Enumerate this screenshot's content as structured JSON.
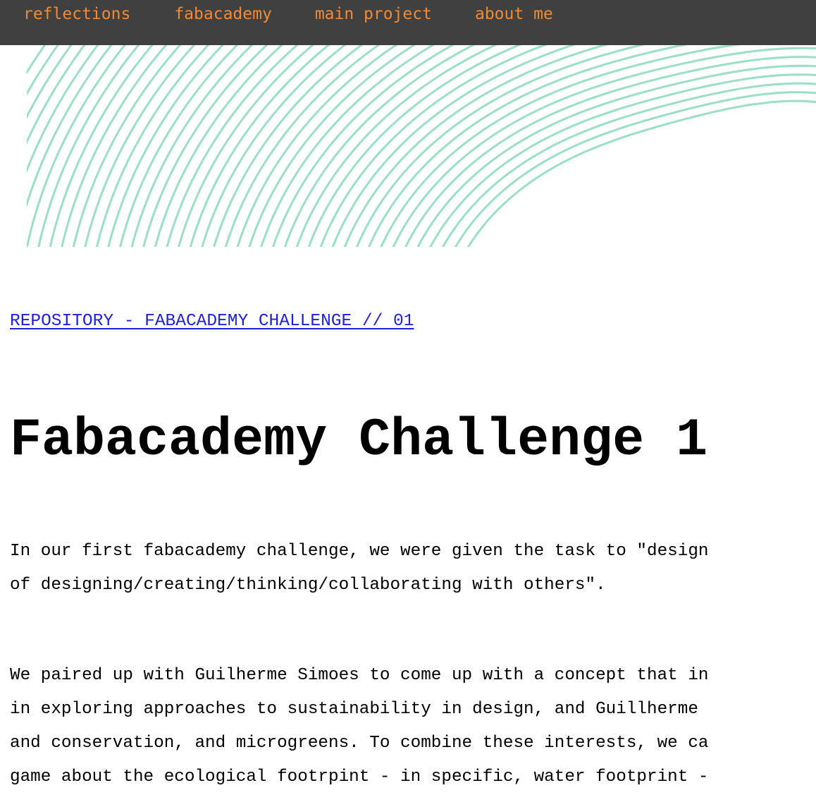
{
  "nav": {
    "items": [
      {
        "label": "reflections"
      },
      {
        "label": "fabacademy"
      },
      {
        "label": "main project"
      },
      {
        "label": "about me"
      }
    ],
    "text_color": "#f08a35",
    "background": "#404040"
  },
  "hero": {
    "line_color": "#8fdcc0",
    "description_icon": "wavy-lines-pattern"
  },
  "main": {
    "repo_link": "REPOSITORY - FABACADEMY CHALLENGE // 01",
    "title": "Fabacademy Challenge 1",
    "paragraph1": [
      "In our first fabacademy challenge, we were given the task to \"design",
      "of designing/creating/thinking/collaborating with others\"."
    ],
    "paragraph2": [
      "We paired up with Guilherme Simoes to come up with a concept that in",
      "in exploring approaches to sustainability in design, and Guillherme",
      "and conservation, and microgreens. To combine these interests, we ca",
      "game about the ecological footrpint - in specific, water footprint -"
    ]
  }
}
